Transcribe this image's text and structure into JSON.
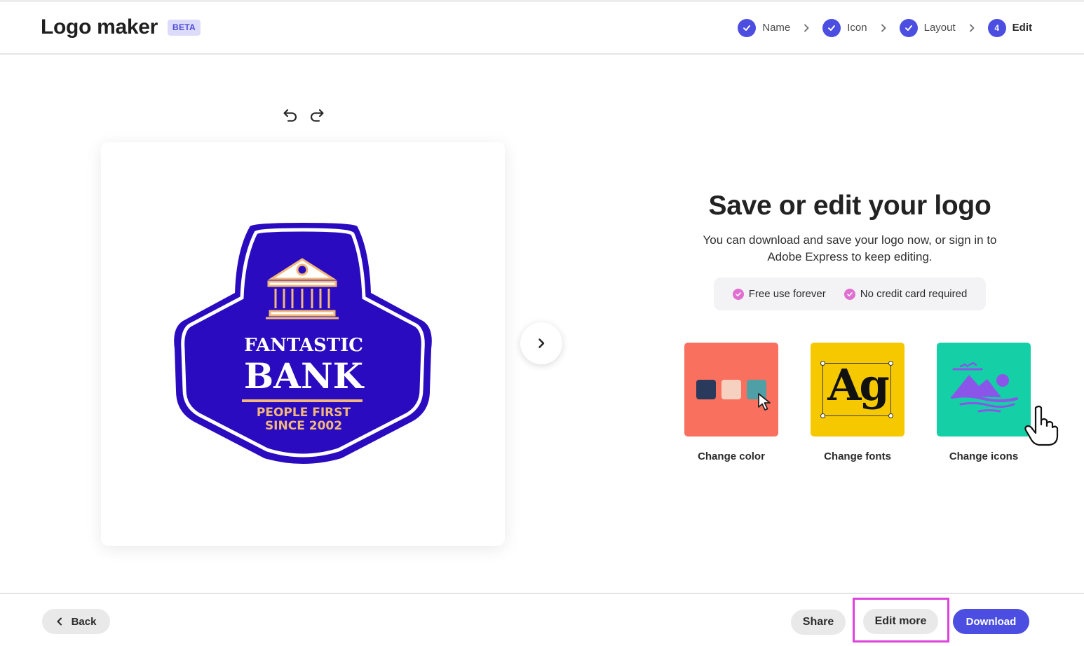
{
  "header": {
    "app_title": "Logo maker",
    "badge": "BETA",
    "steps": [
      {
        "label": "Name",
        "state": "done",
        "icon": "check-icon"
      },
      {
        "label": "Icon",
        "state": "done",
        "icon": "check-icon"
      },
      {
        "label": "Layout",
        "state": "done",
        "icon": "check-icon"
      },
      {
        "label": "Edit",
        "state": "current",
        "number": "4"
      }
    ]
  },
  "canvas": {
    "undo_icon": "undo-icon",
    "redo_icon": "redo-icon",
    "logo": {
      "line1": "FANTASTIC",
      "line2": "BANK",
      "tagline1": "PEOPLE FIRST",
      "tagline2": "SINCE 2002",
      "icon": "bank-building-icon",
      "colors": {
        "badge": "#2a0bbf",
        "accent": "#f2b879",
        "white": "#ffffff"
      }
    },
    "next_icon": "chevron-right-icon"
  },
  "panel": {
    "title": "Save or edit your logo",
    "description": "You can download and save your logo now, or sign in to Adobe Express to keep editing.",
    "perks": [
      "Free use forever",
      "No credit card required"
    ],
    "tiles": [
      {
        "label": "Change color",
        "bg": "#f9705f",
        "swatches": [
          "#2a3a5c",
          "#f7d1bf",
          "#4fa0a6"
        ]
      },
      {
        "label": "Change fonts",
        "bg": "#f5c800",
        "sample": "Ag"
      },
      {
        "label": "Change icons",
        "bg": "#15cfa6",
        "icon_color": "#8a55e8"
      }
    ]
  },
  "footer": {
    "back_label": "Back",
    "share_label": "Share",
    "edit_more_label": "Edit more",
    "download_label": "Download"
  },
  "colors": {
    "accent": "#4b4ee0",
    "highlight": "#dd44dd",
    "perk_check": "#e06fd1"
  }
}
